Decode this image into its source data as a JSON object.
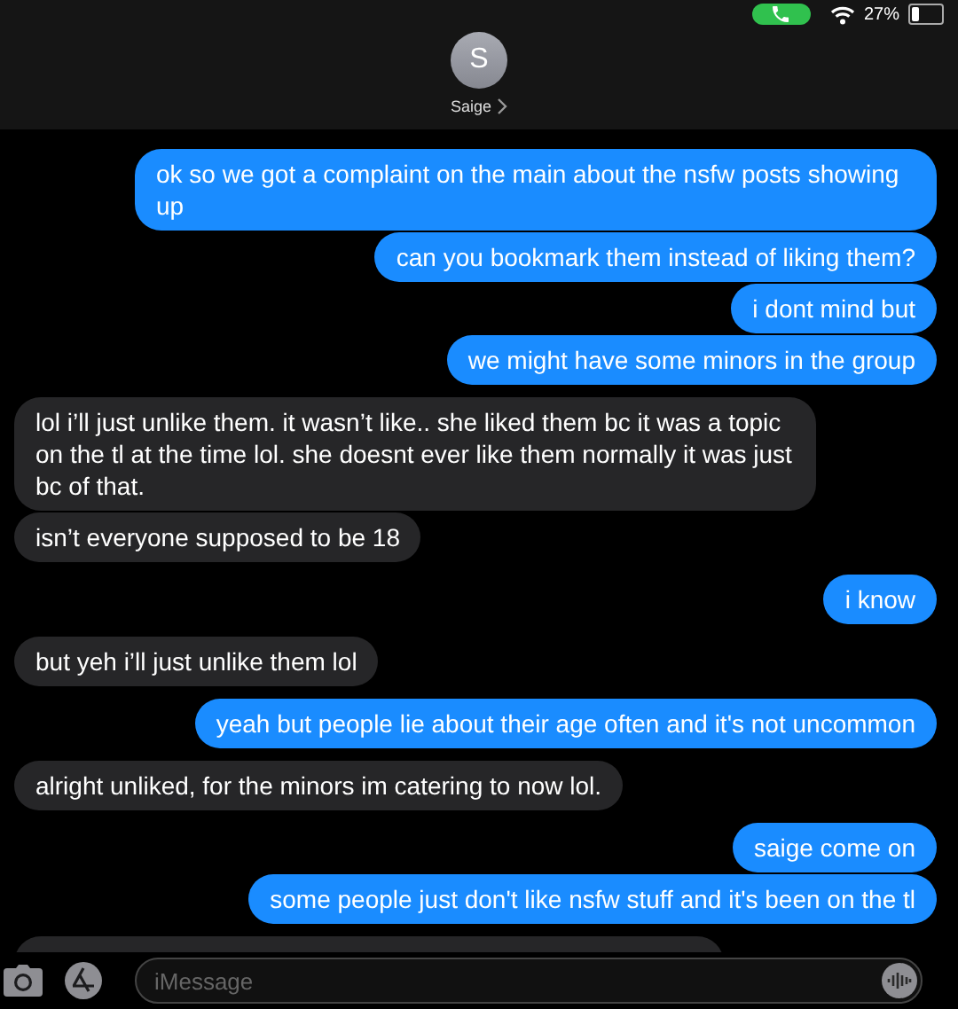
{
  "status_bar": {
    "call_active": true,
    "battery_text": "27%"
  },
  "contact": {
    "initial": "S",
    "name": "Saige"
  },
  "messages": [
    {
      "kind": "sent",
      "text": "ok so we got a complaint on the main about the nsfw posts showing up"
    },
    {
      "kind": "sent",
      "text": "can you bookmark them instead of liking them?"
    },
    {
      "kind": "sent",
      "text": "i dont mind but"
    },
    {
      "kind": "sent",
      "text": "we might have some minors in the group"
    },
    {
      "kind": "received",
      "text": "lol i’ll just unlike them. it wasn’t like.. she liked them bc it was a topic on the tl at the time lol. she doesnt ever like them normally it was just bc of that."
    },
    {
      "kind": "received",
      "text": "isn’t everyone supposed to be 18"
    },
    {
      "kind": "sent",
      "text": "i know"
    },
    {
      "kind": "received",
      "text": "but yeh i’ll just unlike them lol"
    },
    {
      "kind": "sent",
      "text": "yeah but people lie about their age often and it's not uncommon"
    },
    {
      "kind": "received",
      "text": "alright unliked, for the minors im catering to now lol."
    },
    {
      "kind": "sent",
      "text": "saige come on"
    },
    {
      "kind": "sent",
      "text": "some people just don't like nsfw stuff and it's been on the tl"
    },
    {
      "kind": "received",
      "cut": true
    }
  ],
  "composer": {
    "placeholder": "iMessage"
  }
}
